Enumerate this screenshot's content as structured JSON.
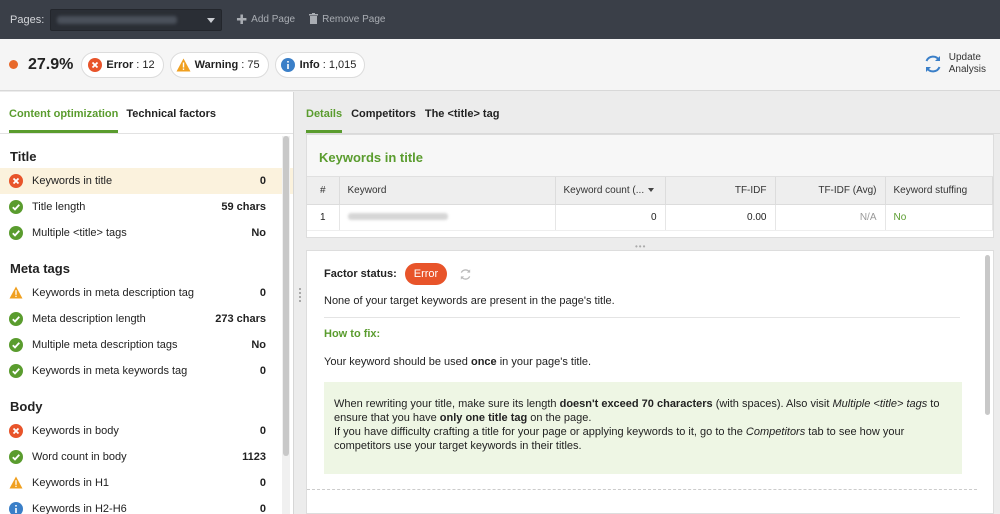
{
  "topbar": {
    "pages_label": "Pages:",
    "add_page": "Add Page",
    "remove_page": "Remove Page"
  },
  "summary": {
    "score": "27.9%",
    "error_label": "Error",
    "error_count": ": 12",
    "warning_label": "Warning",
    "warning_count": ": 75",
    "info_label": "Info",
    "info_count": ": 1,015",
    "update_line1": "Update",
    "update_line2": "Analysis"
  },
  "left_tabs": [
    "Content optimization",
    "Technical factors"
  ],
  "sections": [
    {
      "title": "Title",
      "items": [
        {
          "label": "Keywords in title",
          "value": "0",
          "status": "error"
        },
        {
          "label": "Title length",
          "value": "59 chars",
          "status": "ok"
        },
        {
          "label": "Multiple <title> tags",
          "value": "No",
          "status": "ok"
        }
      ]
    },
    {
      "title": "Meta tags",
      "items": [
        {
          "label": "Keywords in meta description tag",
          "value": "0",
          "status": "warning"
        },
        {
          "label": "Meta description length",
          "value": "273 chars",
          "status": "ok"
        },
        {
          "label": "Multiple meta description tags",
          "value": "No",
          "status": "ok"
        },
        {
          "label": "Keywords in meta keywords tag",
          "value": "0",
          "status": "ok"
        }
      ]
    },
    {
      "title": "Body",
      "items": [
        {
          "label": "Keywords in body",
          "value": "0",
          "status": "error"
        },
        {
          "label": "Word count in body",
          "value": "1123",
          "status": "ok"
        },
        {
          "label": "Keywords in H1",
          "value": "0",
          "status": "warning"
        },
        {
          "label": "Keywords in H2-H6",
          "value": "0",
          "status": "info"
        }
      ]
    }
  ],
  "right_tabs": [
    "Details",
    "Competitors",
    "The <title> tag"
  ],
  "card": {
    "title": "Keywords in title",
    "columns": [
      "#",
      "Keyword",
      "Keyword count (...",
      "TF-IDF",
      "TF-IDF (Avg)",
      "Keyword stuffing"
    ],
    "row": {
      "num": "1",
      "count": "0",
      "tfidf": "0.00",
      "avg": "N/A",
      "stuffing": "No"
    }
  },
  "detail": {
    "factor_status_label": "Factor status:",
    "status": "Error",
    "description": "None of your target keywords are present in the page's title.",
    "how_to_fix": "How to fix:",
    "rule_pre": "Your keyword should be used ",
    "rule_bold": "once",
    "rule_post": " in your page's title.",
    "tip_1a": "When rewriting your title, make sure its length ",
    "tip_1b": "doesn't exceed 70 characters",
    "tip_1c": " (with spaces). Also visit ",
    "tip_1d": "Multiple <title> tags",
    "tip_1e": " to ensure that you have ",
    "tip_1f": "only one title tag",
    "tip_1g": " on the page.",
    "tip_2a": "If you have difficulty crafting a title for your page or applying keywords to it, go to the ",
    "tip_2b": "Competitors",
    "tip_2c": " tab to see how your competitors use your target keywords in their titles."
  },
  "colors": {
    "accent_green": "#5a9c2e",
    "error": "#e8542a",
    "warning": "#f0a020",
    "info": "#3a7fc8"
  }
}
